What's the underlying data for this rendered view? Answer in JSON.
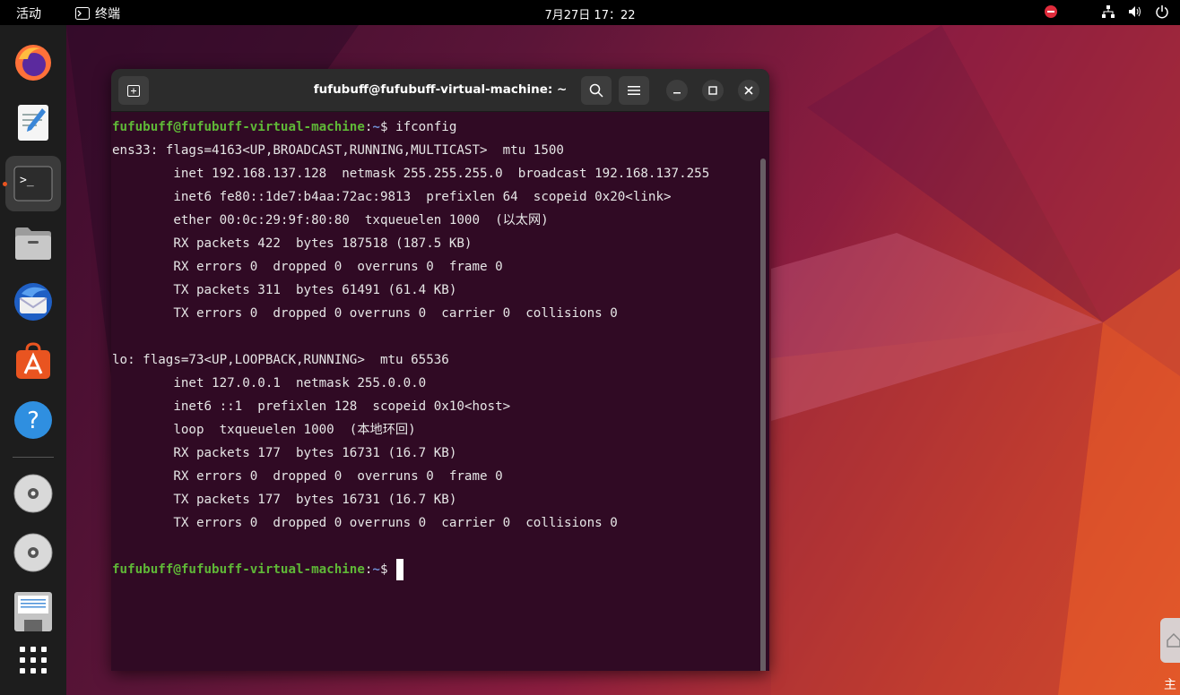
{
  "topbar": {
    "activities": "活动",
    "app_name": "终端",
    "clock": "7月27日  17：22"
  },
  "dock": {
    "items": [
      {
        "name": "firefox-icon"
      },
      {
        "name": "text-editor-icon"
      },
      {
        "name": "terminal-icon"
      },
      {
        "name": "files-icon"
      },
      {
        "name": "thunderbird-icon"
      },
      {
        "name": "app-center-icon"
      },
      {
        "name": "help-icon"
      },
      {
        "name": "cd-drive-icon"
      },
      {
        "name": "cd-drive-icon"
      },
      {
        "name": "floppy-disk-icon"
      },
      {
        "name": "show-apps-icon"
      }
    ]
  },
  "terminal": {
    "title": "fufubuff@fufubuff-virtual-machine: ~",
    "prompt_user": "fufubuff@fufubuff-virtual-machine",
    "prompt_path": "~",
    "prompt_symbol": "$ ",
    "command": "ifconfig",
    "output": [
      "ens33: flags=4163<UP,BROADCAST,RUNNING,MULTICAST>  mtu 1500",
      "        inet 192.168.137.128  netmask 255.255.255.0  broadcast 192.168.137.255",
      "        inet6 fe80::1de7:b4aa:72ac:9813  prefixlen 64  scopeid 0x20<link>",
      "        ether 00:0c:29:9f:80:80  txqueuelen 1000  (以太网)",
      "        RX packets 422  bytes 187518 (187.5 KB)",
      "        RX errors 0  dropped 0  overruns 0  frame 0",
      "        TX packets 311  bytes 61491 (61.4 KB)",
      "        TX errors 0  dropped 0 overruns 0  carrier 0  collisions 0",
      "",
      "lo: flags=73<UP,LOOPBACK,RUNNING>  mtu 65536",
      "        inet 127.0.0.1  netmask 255.0.0.0",
      "        inet6 ::1  prefixlen 128  scopeid 0x10<host>",
      "        loop  txqueuelen 1000  (本地环回)",
      "        RX packets 177  bytes 16731 (16.7 KB)",
      "        RX errors 0  dropped 0  overruns 0  frame 0",
      "        TX packets 177  bytes 16731 (16.7 KB)",
      "        TX errors 0  dropped 0 overruns 0  carrier 0  collisions 0",
      ""
    ]
  },
  "desktop": {
    "corner_text": "主"
  }
}
